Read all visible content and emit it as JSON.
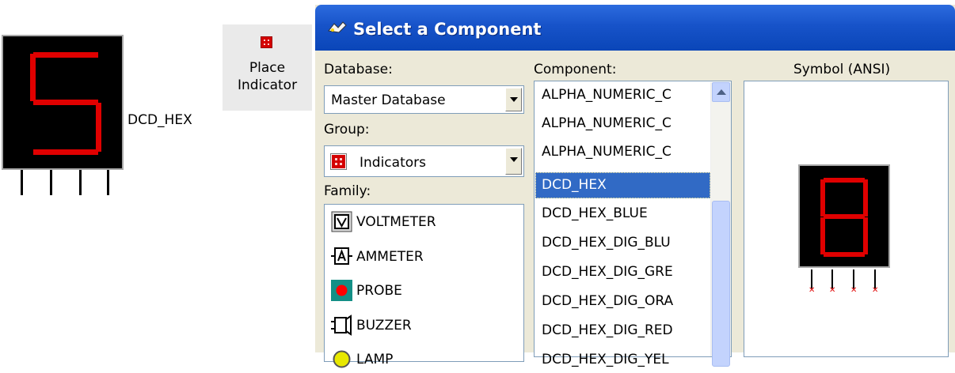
{
  "canvas": {
    "component_label": "DCD_HEX",
    "display_digit": "5",
    "segment_color": "#e00000"
  },
  "toolbar": {
    "place_indicator": [
      "Place",
      "Indicator"
    ],
    "icon": "indicator-icon"
  },
  "dialog": {
    "title": "Select a Component",
    "title_icon": "component-wizard-icon",
    "database_label": "Database:",
    "database_value": "Master Database",
    "group_label": "Group:",
    "group_value": "Indicators",
    "family_label": "Family:",
    "component_label": "Component:",
    "symbol_label": "Symbol (ANSI)",
    "families": [
      {
        "label": "VOLTMETER",
        "icon": "voltmeter-icon"
      },
      {
        "label": "AMMETER",
        "icon": "ammeter-icon"
      },
      {
        "label": "PROBE",
        "icon": "probe-icon"
      },
      {
        "label": "BUZZER",
        "icon": "buzzer-icon"
      },
      {
        "label": "LAMP",
        "icon": "lamp-icon"
      }
    ],
    "components": [
      "ALPHA_NUMERIC_C",
      "ALPHA_NUMERIC_C",
      "ALPHA_NUMERIC_C",
      "DCD_HEX",
      "DCD_HEX_BLUE",
      "DCD_HEX_DIG_BLU",
      "DCD_HEX_DIG_GRE",
      "DCD_HEX_DIG_ORA",
      "DCD_HEX_DIG_RED",
      "DCD_HEX_DIG_YEL"
    ],
    "selected_component": "DCD_HEX",
    "accent": "#316ac5",
    "title_color": "#1753c9"
  }
}
